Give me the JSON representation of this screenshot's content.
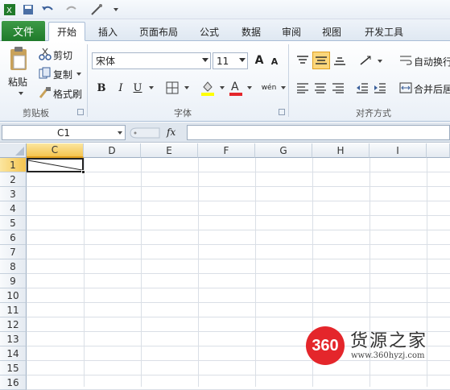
{
  "tabs": {
    "file": "文件",
    "items": [
      "开始",
      "插入",
      "页面布局",
      "公式",
      "数据",
      "审阅",
      "视图",
      "开发工具"
    ]
  },
  "clipboard": {
    "paste": "粘贴",
    "cut": "剪切",
    "copy": "复制",
    "format_painter": "格式刷",
    "group_label": "剪贴板"
  },
  "font": {
    "name": "宋体",
    "size": "11",
    "bold": "B",
    "italic": "I",
    "underline": "U",
    "group_label": "字体",
    "grow_icon": "A",
    "shrink_icon": "A",
    "font_color_icon": "A",
    "wen_icon": "wén"
  },
  "alignment": {
    "wrap_text": "自动换行",
    "merge_center": "合并后居",
    "group_label": "对齐方式"
  },
  "formula_bar": {
    "name_box": "C1",
    "fx": "fx"
  },
  "sheet": {
    "columns": [
      "C",
      "D",
      "E",
      "F",
      "G",
      "H",
      "I"
    ],
    "rows": [
      "1",
      "2",
      "3",
      "4",
      "5",
      "6",
      "7",
      "8",
      "9",
      "10",
      "11",
      "12",
      "13",
      "14",
      "15",
      "16"
    ],
    "selected_column": "C",
    "selected_row": "1"
  },
  "watermark": {
    "logo_text": "360",
    "name": "货源之家",
    "url": "www.360hyzj.com"
  },
  "colors": {
    "file_tab": "#1f7a2a",
    "selected_header": "#f5c44f",
    "watermark_red": "#e4262b"
  }
}
